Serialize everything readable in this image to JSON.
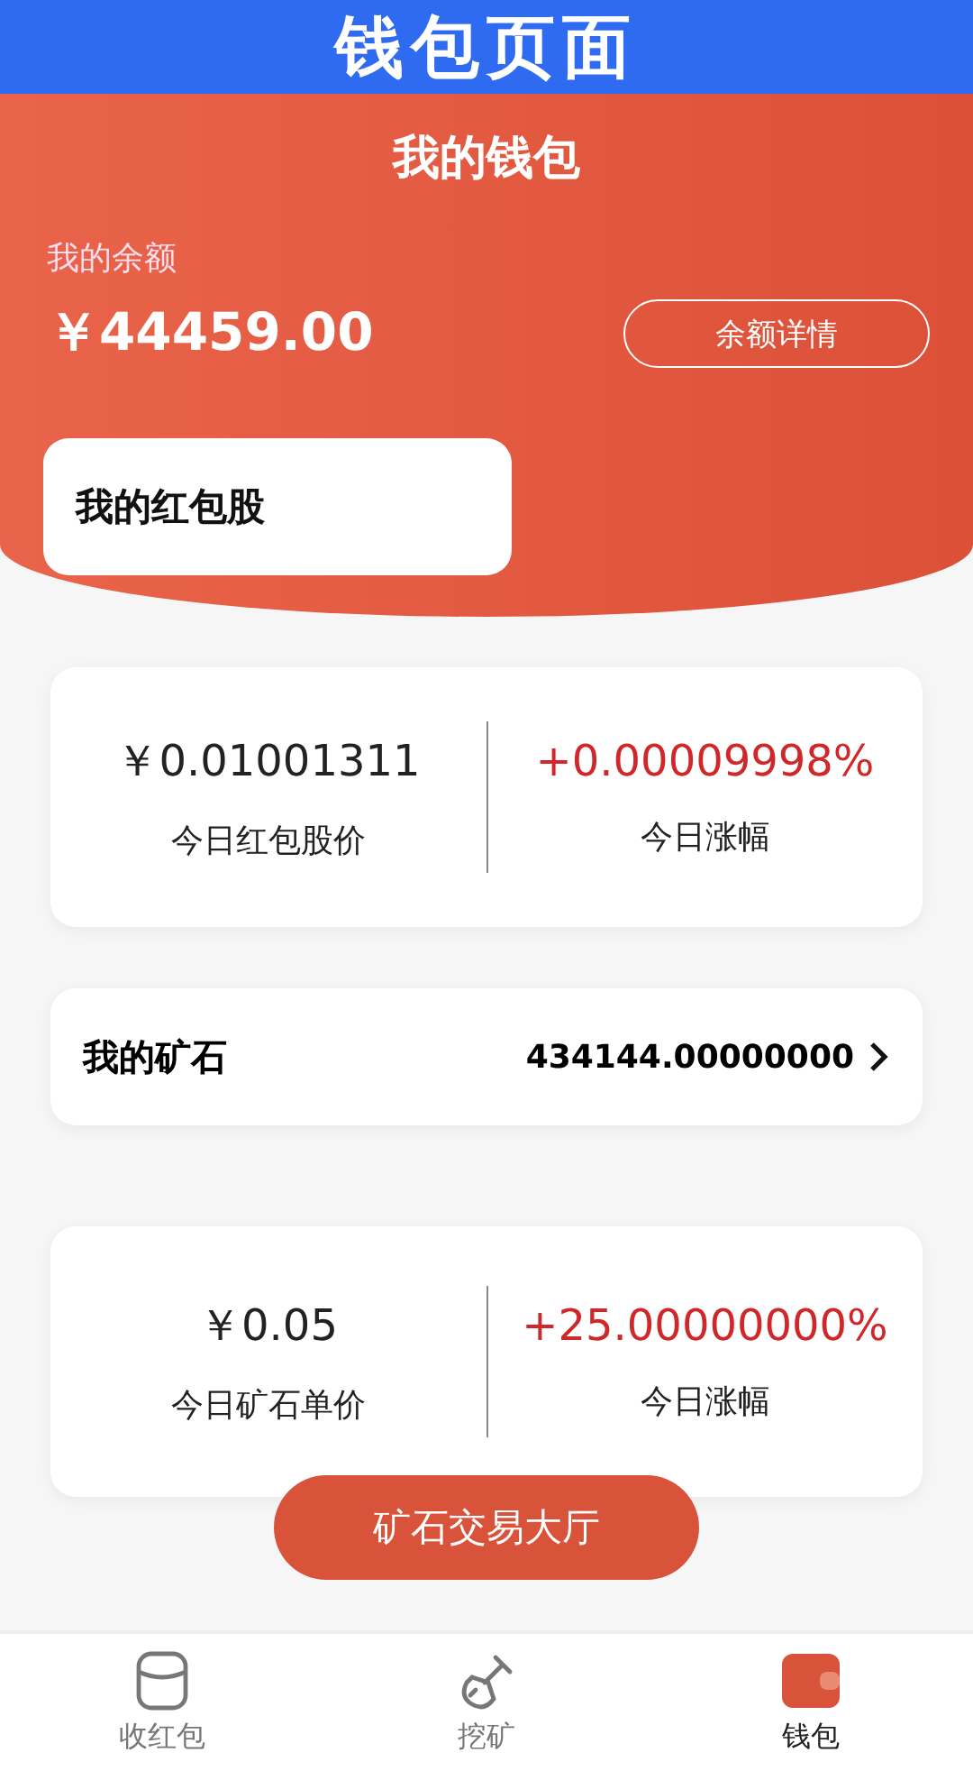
{
  "banner": {
    "title": "钱包页面"
  },
  "header": {
    "title": "我的钱包",
    "balance_label": "我的余额",
    "balance": "￥44459.00",
    "details_button": "余额详情"
  },
  "red_packet_stock": {
    "title": "我的红包股"
  },
  "stock_stats": [
    {
      "value": "￥0.01001311",
      "label": "今日红包股价",
      "kind": "price"
    },
    {
      "value": "+0.00009998%",
      "label": "今日涨幅",
      "kind": "change"
    }
  ],
  "ore": {
    "title": "我的矿石",
    "value": "434144.00000000"
  },
  "ore_stats": [
    {
      "value": "￥0.05",
      "label": "今日矿石单价",
      "kind": "price"
    },
    {
      "value": "+25.00000000%",
      "label": "今日涨幅",
      "kind": "change"
    }
  ],
  "trade_button": "矿石交易大厅",
  "tabs": [
    {
      "label": "收红包",
      "kind": "cylinder",
      "selected": false
    },
    {
      "label": "挖矿",
      "kind": "shovel",
      "selected": false
    },
    {
      "label": "钱包",
      "kind": "wallet",
      "selected": true
    }
  ]
}
